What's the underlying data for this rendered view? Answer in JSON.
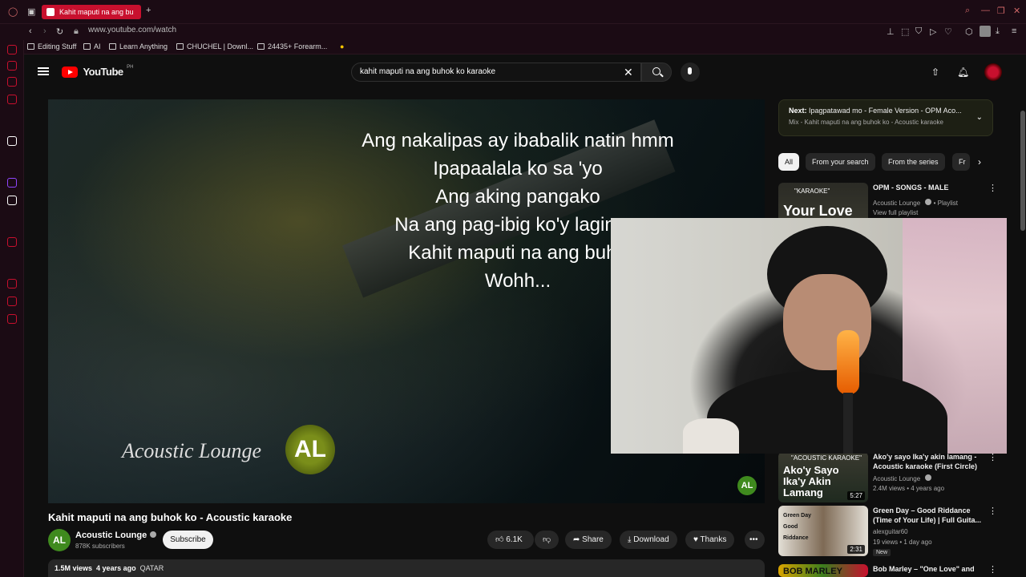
{
  "browser": {
    "tab_title": "Kahit maputi na ang bu",
    "url": "www.youtube.com/watch",
    "bookmarks": [
      "Editing Stuff",
      "AI",
      "Learn Anything",
      "CHUCHEL | Downl...",
      "24435+ Forearm..."
    ]
  },
  "header": {
    "logo_text": "YouTube",
    "country_code": "PH",
    "search_value": "kahit maputi na ang buhok ko karaoke"
  },
  "player": {
    "lyrics": [
      "Ang nakalipas ay ibabalik natin hmm",
      "Ipapaalala ko sa 'yo",
      "Ang aking pangako",
      "Na ang pag-ibig ko'y laging s",
      "Kahit maputi na ang buho",
      "Wohh..."
    ],
    "watermark_text": "Acoustic Lounge",
    "logo_letters": "AL"
  },
  "video": {
    "title": "Kahit maputi na ang buhok ko - Acoustic karaoke",
    "channel_name": "Acoustic Lounge",
    "subscribers": "878K subscribers",
    "subscribe_label": "Subscribe",
    "likes": "6.1K",
    "share_label": "Share",
    "download_label": "Download",
    "thanks_label": "Thanks",
    "views": "1.5M views",
    "age": "4 years ago",
    "tag": "QATAR"
  },
  "sidebar": {
    "next_label": "Next:",
    "next_title": "Ipagpatawad mo - Female Version - OPM Aco...",
    "next_sub": "Mix - Kahit maputi na ang buhok ko - Acoustic karaoke",
    "chips": [
      "All",
      "From your search",
      "From the series",
      "Fr"
    ],
    "recs": [
      {
        "title": "OPM - SONGS - MALE",
        "channel": "Acoustic Lounge",
        "meta": "• Playlist",
        "extra": "View full playlist",
        "thumb_text": "Your Love",
        "thumb_top": "\"KARAOKE\""
      },
      {
        "title": "Ako'y sayo Ika'y akin lamang - Acoustic karaoke (First Circle)",
        "channel": "Acoustic Lounge",
        "meta": "2.4M views • 4 years ago",
        "thumb_text": "Ako'y Sayo Ika'y Akin Lamang",
        "thumb_top": "\"ACOUSTIC KARAOKE\"",
        "duration": "5:27"
      },
      {
        "title": "Green Day – Good Riddance (Time of Your Life) | Full Guita...",
        "channel": "alexguitar60",
        "meta": "19 views • 1 day ago",
        "badge": "New",
        "thumb_text": "Green Day Good Riddance",
        "duration": "2:31"
      },
      {
        "title": "Bob Marley – \"One Love\" and",
        "thumb_text": "BOB MARLEY"
      }
    ]
  },
  "colors": {
    "accent": "#c8102e",
    "youtube_red": "#ff0000",
    "background": "#0f0f0f",
    "pill": "#272727"
  }
}
